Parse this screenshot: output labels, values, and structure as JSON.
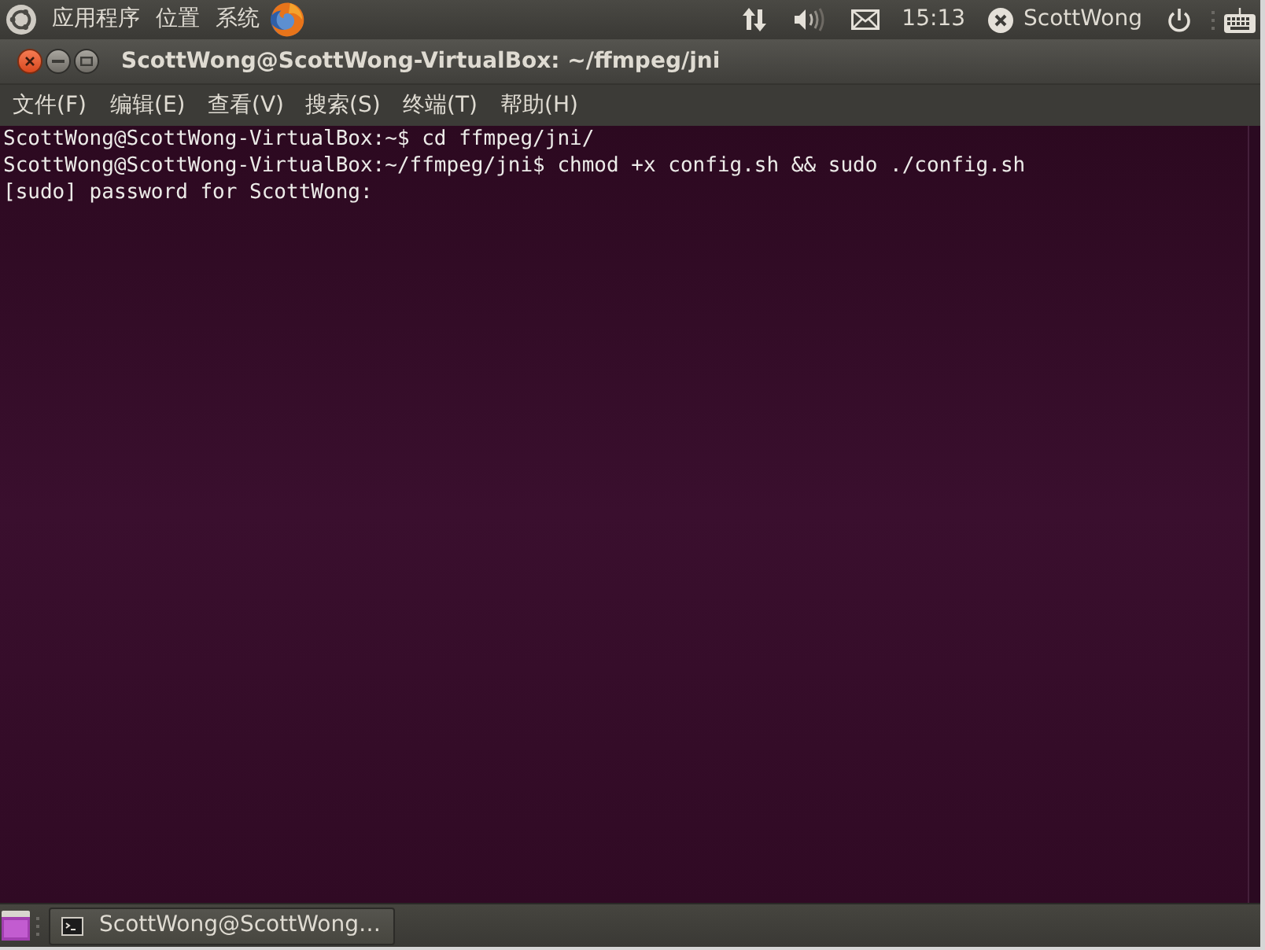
{
  "top_panel": {
    "menus": [
      {
        "label": "应用程序"
      },
      {
        "label": "位置"
      },
      {
        "label": "系统"
      }
    ],
    "clock": "15:13",
    "user": "ScottWong"
  },
  "window": {
    "title": "ScottWong@ScottWong-VirtualBox: ~/ffmpeg/jni",
    "menu": [
      {
        "label": "文件(F)"
      },
      {
        "label": "编辑(E)"
      },
      {
        "label": "查看(V)"
      },
      {
        "label": "搜索(S)"
      },
      {
        "label": "终端(T)"
      },
      {
        "label": "帮助(H)"
      }
    ]
  },
  "terminal": {
    "lines": [
      "ScottWong@ScottWong-VirtualBox:~$ cd ffmpeg/jni/",
      "ScottWong@ScottWong-VirtualBox:~/ffmpeg/jni$ chmod +x config.sh && sudo ./config.sh",
      "[sudo] password for ScottWong:"
    ]
  },
  "taskbar": {
    "tasks": [
      {
        "label": "ScottWong@ScottWong…",
        "selected": true
      }
    ]
  }
}
